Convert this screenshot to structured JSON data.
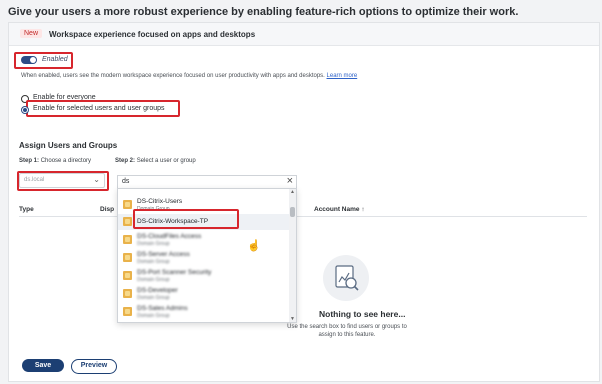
{
  "headline": "Give your users a more robust experience by enabling feature-rich options to optimize their work.",
  "banner": {
    "badge": "New",
    "title": "Workspace experience focused on apps and desktops"
  },
  "toggle": {
    "label": "Enabled",
    "on": true
  },
  "description": {
    "text": "When enabled, users see the modern workspace experience focused on user productivity with apps and desktops.",
    "link": "Learn more"
  },
  "radio_options": [
    {
      "label": "Enable for everyone",
      "selected": false
    },
    {
      "label": "Enable for selected users and user groups",
      "selected": true
    }
  ],
  "assign": {
    "title": "Assign Users and Groups",
    "step1_prefix": "Step 1:",
    "step1_text": "Choose a directory",
    "step2_prefix": "Step 2:",
    "step2_text": "Select a user or group",
    "directory_value": "ds.local",
    "search_value": "ds"
  },
  "table": {
    "col_type": "Type",
    "col_display": "Disp",
    "col_account": "Account Name",
    "sort_icon": "arrow-up-icon"
  },
  "dropdown_items": [
    {
      "name": "",
      "sub": "",
      "blurred": true
    },
    {
      "name": "DS-Citrix-Users",
      "sub": "Domain Group",
      "blurred": false
    },
    {
      "name": "DS-Citrix-Workspace-TP",
      "sub": "",
      "blurred": false
    },
    {
      "name": "DS-CloudFiles Access",
      "sub": "Domain Group",
      "blurred": true
    },
    {
      "name": "DS-Server Access",
      "sub": "Domain Group",
      "blurred": true
    },
    {
      "name": "DS-Port Scanner Security",
      "sub": "Domain Group",
      "blurred": true
    },
    {
      "name": "DS-Developer",
      "sub": "Domain Group",
      "blurred": true
    },
    {
      "name": "DS-Sales Admins",
      "sub": "Domain Group",
      "blurred": true
    }
  ],
  "empty_state": {
    "title": "Nothing to see here...",
    "subtitle": "Use the search box to find users or groups to assign to this feature."
  },
  "buttons": {
    "save": "Save",
    "preview": "Preview"
  },
  "colors": {
    "accent": "#1c3f73",
    "highlight_box": "#d7262d",
    "group_icon": "#e9b24a"
  }
}
